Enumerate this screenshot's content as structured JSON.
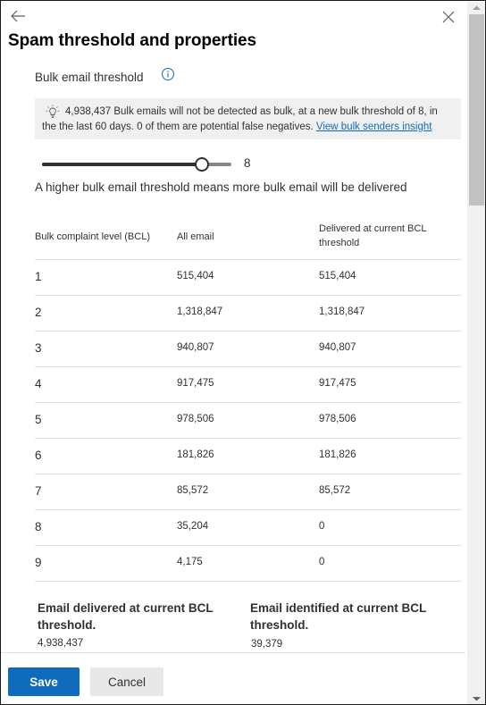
{
  "panel": {
    "title": "Spam threshold and properties",
    "back_icon": "arrow-left-icon",
    "close_icon": "close-icon"
  },
  "bulk": {
    "label": "Bulk email threshold",
    "info_icon": "info-icon",
    "banner": {
      "icon": "lightbulb-icon",
      "line1": "4,938,437 Bulk emails will not be detected as bulk, at a new bulk threshold of 8, in",
      "line2_prefix": "the the last 60 days. 0 of them are potential false negatives.",
      "link": "View bulk senders insight"
    },
    "slider": {
      "value": 8,
      "min": 0,
      "max": 9,
      "value_label": "8"
    },
    "helper": "A higher bulk email threshold means more bulk email will be delivered"
  },
  "table": {
    "headers": [
      "Bulk complaint level (BCL)",
      "All email",
      "Delivered at current BCL threshold"
    ],
    "rows": [
      [
        "1",
        "515,404",
        "515,404"
      ],
      [
        "2",
        "1,318,847",
        "1,318,847"
      ],
      [
        "3",
        "940,807",
        "940,807"
      ],
      [
        "4",
        "917,475",
        "917,475"
      ],
      [
        "5",
        "978,506",
        "978,506"
      ],
      [
        "6",
        "181,826",
        "181,826"
      ],
      [
        "7",
        "85,572",
        "85,572"
      ],
      [
        "8",
        "35,204",
        "0"
      ],
      [
        "9",
        "4,175",
        "0"
      ]
    ]
  },
  "summary": {
    "delivered_label": "Email delivered at current BCL threshold.",
    "delivered_value": "4,938,437",
    "identified_label": "Email identified at current BCL threshold.",
    "identified_value": "39,379"
  },
  "footer": {
    "save_label": "Save",
    "cancel_label": "Cancel"
  },
  "colors": {
    "primary": "#0f6cbd",
    "banner_bg": "#f0f0f0",
    "text": "#323130"
  }
}
